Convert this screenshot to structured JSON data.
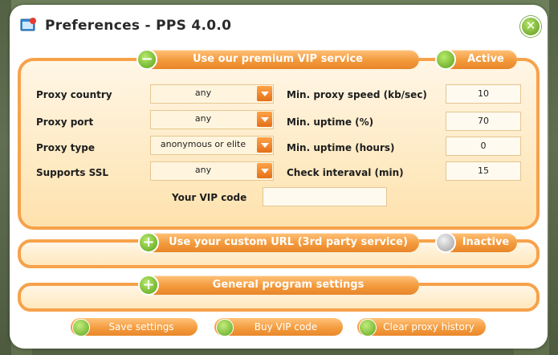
{
  "window": {
    "title": "Preferences - PPS 4.0.0"
  },
  "vip": {
    "header": "Use our premium VIP service",
    "status": "Active",
    "fields": {
      "proxy_country": {
        "label": "Proxy country",
        "value": "any"
      },
      "proxy_port": {
        "label": "Proxy port",
        "value": "any"
      },
      "proxy_type": {
        "label": "Proxy type",
        "value": "anonymous or elite"
      },
      "supports_ssl": {
        "label": "Supports SSL",
        "value": "any"
      },
      "min_speed": {
        "label": "Min. proxy speed (kb/sec)",
        "value": "10"
      },
      "min_uptime_pct": {
        "label": "Min. uptime (%)",
        "value": "70"
      },
      "min_uptime_hours": {
        "label": "Min. uptime (hours)",
        "value": "0"
      },
      "check_interval": {
        "label": "Check interaval (min)",
        "value": "15"
      },
      "vip_code": {
        "label": "Your VIP code",
        "value": ""
      }
    }
  },
  "custom_url": {
    "header": "Use your custom URL (3rd party service)",
    "status": "Inactive"
  },
  "general": {
    "header": "General program settings"
  },
  "buttons": {
    "save": "Save settings",
    "buy_vip": "Buy VIP code",
    "clear_history": "Clear proxy history"
  },
  "icons": {
    "app": "app-window-icon",
    "close": "close-icon",
    "collapse": "minus-icon",
    "expand": "plus-icon",
    "save": "floppy-disk-icon",
    "key": "key-icon",
    "clear": "download-arrow-icon"
  },
  "colors": {
    "accent": "#f39a3c",
    "panel_border": "#f6a24a",
    "active": "#5ea51f"
  }
}
